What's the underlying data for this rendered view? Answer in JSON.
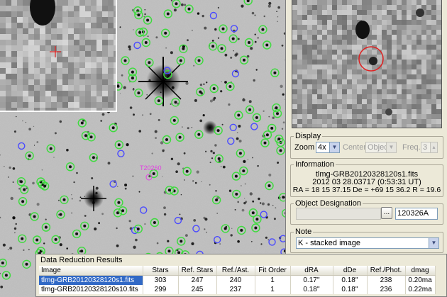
{
  "display": {
    "legend": "Display",
    "zoom_label": "Zoom",
    "zoom_value": "4x",
    "center_label": "Center",
    "center_value": "Object",
    "freq_label": "Freq.",
    "freq_value": "3"
  },
  "information": {
    "legend": "Information",
    "filename": "tlmg-GRB20120328120s1.fits",
    "datetime": "2012 03 28.03717 (0:53:31 UT)",
    "coords": "RA = 18 15 37.15   De = +69 15 36.2   R = 19.6"
  },
  "object_designation": {
    "legend": "Object Designation",
    "browse_label": "...",
    "value": "120326A"
  },
  "note": {
    "legend": "Note",
    "value": "K - stacked image"
  },
  "sky_label": "T20260",
  "results": {
    "title": "Data Reduction Results",
    "columns": [
      "Image",
      "Stars",
      "Ref. Stars",
      "Ref./Ast.",
      "Fit Order",
      "dRA",
      "dDe",
      "Ref./Phot.",
      "dmag"
    ],
    "rows": [
      [
        "tlmg-GRB20120328120s1.fits",
        "303",
        "247",
        "240",
        "1",
        "0.17''",
        "0.18''",
        "238",
        "0.20ma"
      ],
      [
        "tlmg-GRB20120328120s10.fits",
        "299",
        "245",
        "237",
        "1",
        "0.18''",
        "0.18''",
        "236",
        "0.22ma"
      ]
    ]
  },
  "colors": {
    "panel_bg": "#ece9d8",
    "selection": "#3169c6",
    "marker_green": "#3cdc3c",
    "marker_blue": "#4a4aff",
    "target_red": "#e02020",
    "label_magenta": "#e040e0"
  }
}
